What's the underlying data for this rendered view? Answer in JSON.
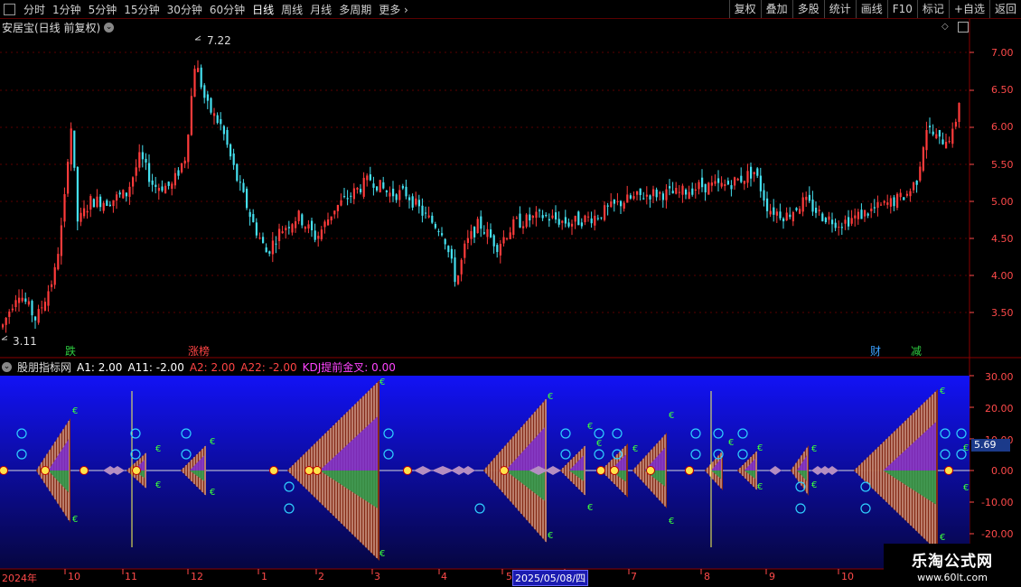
{
  "toolbar": {
    "periods": [
      "分时",
      "1分钟",
      "5分钟",
      "15分钟",
      "30分钟",
      "60分钟",
      "日线",
      "周线",
      "月线",
      "多周期",
      "更多"
    ],
    "active_period": "日线",
    "right_buttons": [
      "复权",
      "叠加",
      "多股",
      "统计",
      "画线",
      "F10",
      "标记",
      "+自选",
      "返回"
    ]
  },
  "chart": {
    "title": "安居宝(日线 前复权)",
    "high_label": "7.22",
    "low_label": "3.11",
    "price_axis": [
      "7.00",
      "6.50",
      "6.00",
      "5.50",
      "5.00",
      "4.50",
      "4.00",
      "3.50"
    ],
    "signals": [
      {
        "text": "跌",
        "color": "#2ecc40"
      },
      {
        "text": "涨",
        "color": "#ff4444"
      },
      {
        "text": "榜",
        "color": "#ff4444"
      },
      {
        "text": "财",
        "color": "#3aa0ff"
      },
      {
        "text": "减",
        "color": "#2ecc40"
      }
    ]
  },
  "indicator": {
    "name": "股朋指标网",
    "values": [
      {
        "label": "A1: 2.00",
        "color": "#ffffff"
      },
      {
        "label": "A11: -2.00",
        "color": "#ffffff"
      },
      {
        "label": "A2: 2.00",
        "color": "#ff4444"
      },
      {
        "label": "A22: -2.00",
        "color": "#ff4444"
      },
      {
        "label": "KDJ提前金叉: 0.00",
        "color": "#ff44ff"
      }
    ],
    "axis": [
      "30.00",
      "20.00",
      "10.00",
      "0.00",
      "-10.00",
      "-20.00"
    ],
    "current_value": "5.69"
  },
  "dates": {
    "labels": [
      "2024年",
      "10",
      "11",
      "12",
      "1",
      "2",
      "3",
      "4",
      "5",
      "6",
      "7",
      "8",
      "9",
      "10"
    ],
    "cursor_date": "2025/05/08/四"
  },
  "watermark": {
    "title": "乐淘公式网",
    "url": "www.60lt.com"
  },
  "colors": {
    "up": "#ff3b3b",
    "down": "#45e0f0",
    "axis": "#ff4a4a",
    "panel_top": "#1010f0",
    "panel_bottom": "#070745",
    "triangle_body": "#8b2c10"
  }
}
